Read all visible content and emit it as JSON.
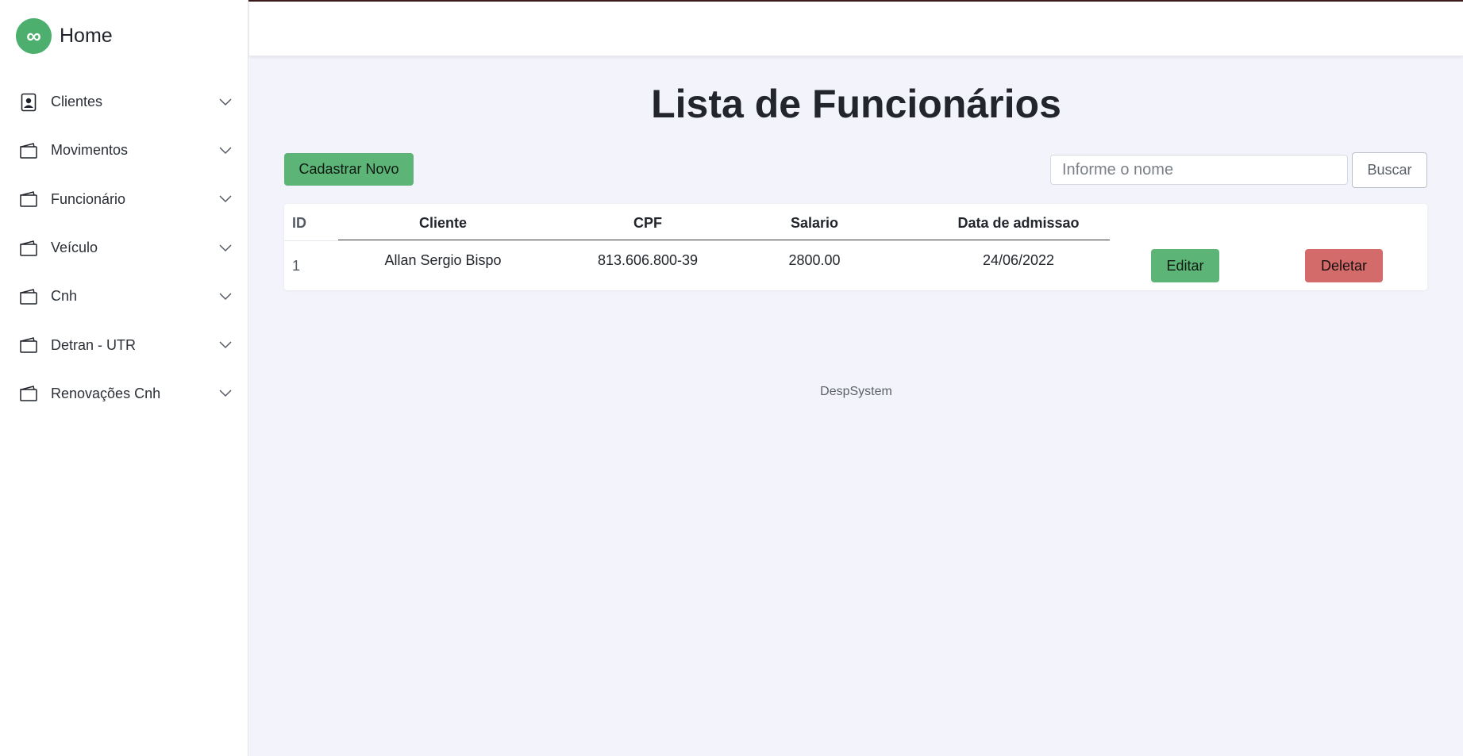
{
  "sidebar": {
    "brand_title": "Home",
    "brand_icon": "infinity-icon",
    "items": [
      {
        "label": "Clientes",
        "icon": "contact-card-icon"
      },
      {
        "label": "Movimentos",
        "icon": "wallet-icon"
      },
      {
        "label": "Funcionário",
        "icon": "wallet-icon"
      },
      {
        "label": "Veículo",
        "icon": "wallet-icon"
      },
      {
        "label": "Cnh",
        "icon": "wallet-icon"
      },
      {
        "label": "Detran - UTR",
        "icon": "wallet-icon"
      },
      {
        "label": "Renovações Cnh",
        "icon": "wallet-icon"
      }
    ]
  },
  "main": {
    "title": "Lista de Funcionários",
    "new_button": "Cadastrar Novo",
    "search": {
      "placeholder": "Informe o nome",
      "value": "",
      "button": "Buscar"
    },
    "table": {
      "columns": [
        "ID",
        "Cliente",
        "CPF",
        "Salario",
        "Data de admissao"
      ],
      "rows": [
        {
          "id": "1",
          "cliente": "Allan Sergio Bispo",
          "cpf": "813.606.800-39",
          "salario": "2800.00",
          "data": "24/06/2022",
          "edit": "Editar",
          "delete": "Deletar"
        }
      ]
    },
    "footer": "DespSystem"
  },
  "colors": {
    "accent_green": "#5cb476",
    "danger_red": "#d46b6b",
    "background": "#f3f4fb"
  }
}
